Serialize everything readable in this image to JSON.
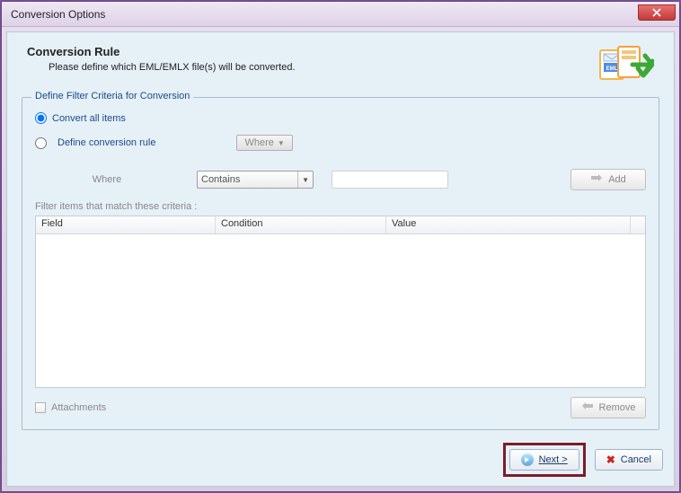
{
  "window": {
    "title": "Conversion Options"
  },
  "header": {
    "title": "Conversion Rule",
    "subtitle": "Please define which EML/EMLX file(s) will be converted."
  },
  "fieldset": {
    "legend": "Define Filter Criteria for Conversion",
    "radio_all": "Convert all items",
    "radio_rule": "Define conversion rule",
    "where_button": "Where",
    "where_label": "Where",
    "condition_selected": "Contains",
    "value_input": "",
    "add_button": "Add",
    "criteria_label": "Filter items that match these criteria :",
    "columns": {
      "field": "Field",
      "condition": "Condition",
      "value": "Value"
    },
    "rows": [],
    "attachments_label": "Attachments",
    "remove_button": "Remove"
  },
  "footer": {
    "next": "Next >",
    "cancel": "Cancel"
  }
}
